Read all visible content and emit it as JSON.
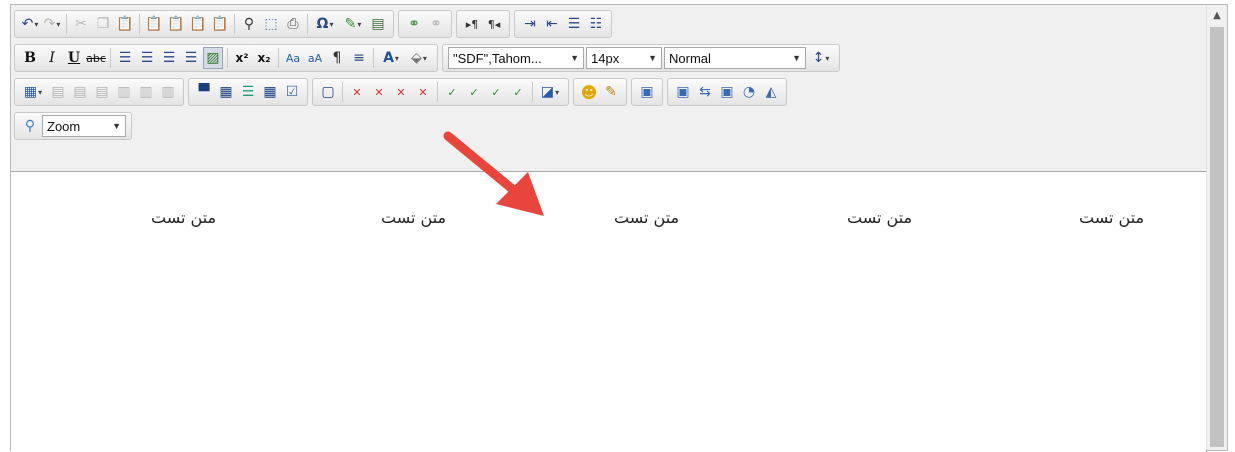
{
  "toolbar": {
    "font_name": "\"SDF\",Tahom...",
    "font_size": "14px",
    "format": "Normal",
    "zoom": "Zoom",
    "glyphs": {
      "bold": "B",
      "italic": "I",
      "underline": "U",
      "strike": "abc",
      "omega": "Ω",
      "font_color": "A",
      "superscript": "x²",
      "subscript": "x₂",
      "pilcrow_ltr": "▸¶",
      "pilcrow_rtl": "¶◂"
    }
  },
  "editor": {
    "items": [
      "متن تست",
      "متن تست",
      "متن تست",
      "متن تست",
      "متن تست"
    ]
  },
  "colors": {
    "arrow": "#e8453c",
    "toolbar_bg": "#f0f0f0",
    "accent_blue": "#2a4a8a"
  },
  "icons": [
    "undo-icon",
    "redo-icon",
    "cut-icon",
    "copy-icon",
    "paste-icon",
    "paste-text-icon",
    "paste-word-icon",
    "find-icon",
    "select-all-icon",
    "print-icon",
    "special-char-icon",
    "cleanup-icon",
    "link-icon",
    "unlink-icon",
    "ltr-icon",
    "rtl-icon",
    "indent-icon",
    "outdent-icon",
    "numbered-list-icon",
    "bullet-list-icon",
    "table-icon",
    "emoticon-icon",
    "image-icon",
    "zoom-icon",
    "scroll-up-icon"
  ]
}
